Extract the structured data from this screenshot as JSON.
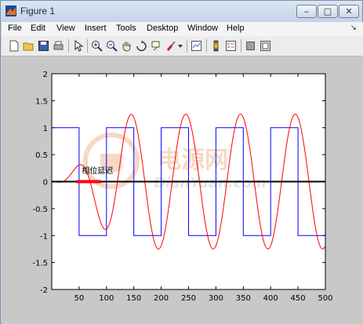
{
  "window": {
    "title": "Figure 1",
    "min_label": "‒",
    "max_label": "□",
    "close_label": "✕"
  },
  "menu": {
    "items": [
      "File",
      "Edit",
      "View",
      "Insert",
      "Tools",
      "Desktop",
      "Window",
      "Help"
    ],
    "dock_label": "↘"
  },
  "toolbar": {
    "icons": [
      "new-figure-icon",
      "open-file-icon",
      "save-icon",
      "print-icon",
      "edit-plot-arrow-icon",
      "zoom-in-icon",
      "zoom-out-icon",
      "pan-hand-icon",
      "rotate-3d-icon",
      "data-cursor-icon",
      "brush-icon",
      "brush-dropdown-icon",
      "link-plot-icon",
      "colorbar-icon",
      "legend-icon",
      "hide-plot-tools-icon",
      "show-plot-tools-icon"
    ]
  },
  "watermark": {
    "cn_text": "电源网",
    "en_text": "DianYuan.com"
  },
  "chart_data": {
    "type": "line",
    "title": "",
    "xlabel": "",
    "ylabel": "",
    "xlim": [
      0,
      500
    ],
    "ylim": [
      -2,
      2
    ],
    "xticks": [
      "50",
      "100",
      "150",
      "200",
      "250",
      "300",
      "350",
      "400",
      "450",
      "500"
    ],
    "yticks": [
      "-2",
      "-1.5",
      "-1",
      "-0.5",
      "0",
      "0.5",
      "1",
      "1.5",
      "2"
    ],
    "annotation": {
      "text": "相位延迟",
      "x": 55,
      "y": 0.15
    },
    "series": [
      {
        "style": "square",
        "color": "#0000ff",
        "amplitude": 1,
        "period": 100,
        "start": 0,
        "end": 500
      },
      {
        "style": "sine-buildup",
        "color": "#ff0000",
        "amplitude": 1.25,
        "period": 100,
        "phase_offset": 20,
        "buildup_end": 150
      },
      {
        "style": "zero-line",
        "color": "#000000",
        "y": 0
      },
      {
        "style": "delay-marker",
        "color": "#ff0000",
        "x": [
          45,
          90
        ],
        "y": [
          0,
          0
        ]
      }
    ]
  }
}
